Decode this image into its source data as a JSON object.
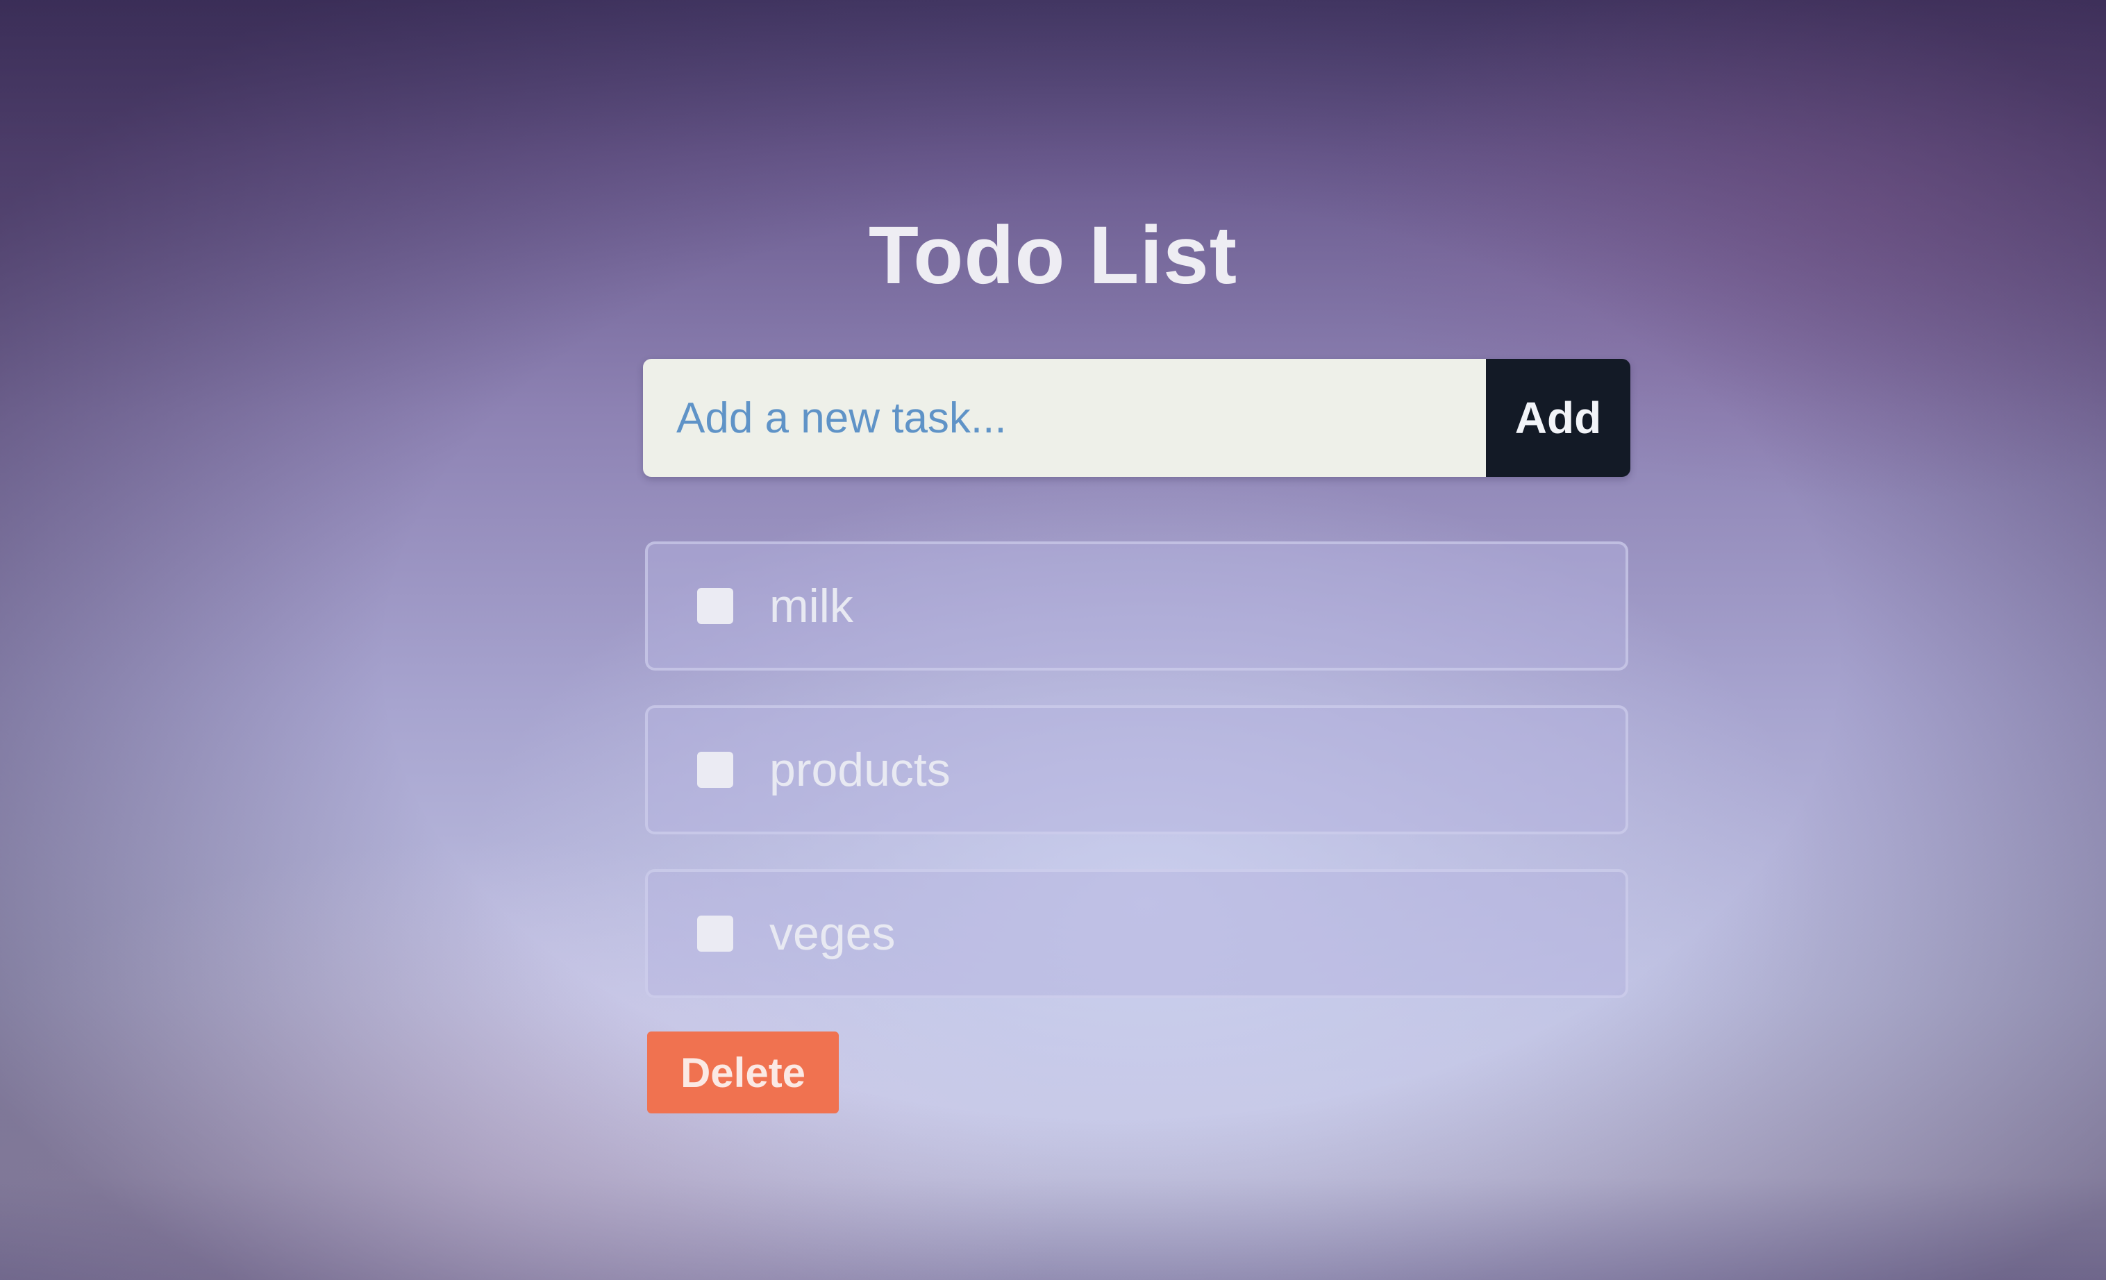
{
  "app": {
    "title": "Todo List"
  },
  "add_form": {
    "input_placeholder": "Add a new task...",
    "input_value": "",
    "add_button_label": "Add"
  },
  "tasks": [
    {
      "label": "milk",
      "checked": false
    },
    {
      "label": "products",
      "checked": false
    },
    {
      "label": "veges",
      "checked": false
    }
  ],
  "actions": {
    "delete_button_label": "Delete"
  },
  "colors": {
    "add_button": "#131a26",
    "delete_button": "#f07250",
    "input_background": "#eef0e9",
    "placeholder_text": "#5f93c7"
  },
  "icons": {
    "task_checkbox": "checkbox-icon"
  }
}
